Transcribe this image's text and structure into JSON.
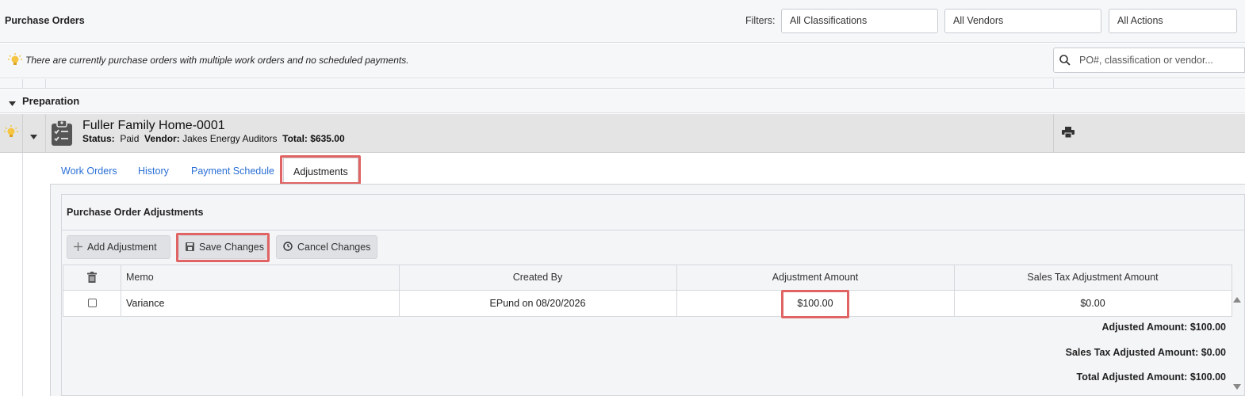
{
  "header": {
    "title": "Purchase Orders",
    "filters_label": "Filters:",
    "filters": [
      "All Classifications",
      "All Vendors",
      "All Actions"
    ]
  },
  "notice": {
    "text": "There are currently purchase orders with multiple work orders and no scheduled payments."
  },
  "search": {
    "placeholder": "PO#, classification or vendor..."
  },
  "group": {
    "label": "Preparation"
  },
  "purchase_order": {
    "name": "Fuller Family Home-0001",
    "status_label": "Status:",
    "status": "Paid",
    "vendor_label": "Vendor:",
    "vendor": "Jakes Energy Auditors",
    "total_label": "Total:",
    "total": "$635.00"
  },
  "tabs": [
    {
      "label": "Work Orders"
    },
    {
      "label": "History"
    },
    {
      "label": "Payment Schedule"
    },
    {
      "label": "Adjustments",
      "active": true
    }
  ],
  "adjustments": {
    "title": "Purchase Order Adjustments",
    "buttons": {
      "add": "Add Adjustment",
      "save": "Save Changes",
      "cancel": "Cancel Changes"
    },
    "columns": [
      "Memo",
      "Created By",
      "Adjustment Amount",
      "Sales Tax Adjustment Amount"
    ],
    "rows": [
      {
        "memo": "Variance",
        "created_by": "EPund on 08/20/2026",
        "amount": "$100.00",
        "sales_tax": "$0.00"
      }
    ],
    "totals": {
      "adjusted": "Adjusted Amount: $100.00",
      "sales_tax": "Sales Tax Adjusted Amount: $0.00",
      "total": "Total Adjusted Amount: $100.00"
    }
  },
  "colors": {
    "accent_link": "#2a6fd6",
    "highlight": "#e06464",
    "bulb": "#f5c542"
  }
}
